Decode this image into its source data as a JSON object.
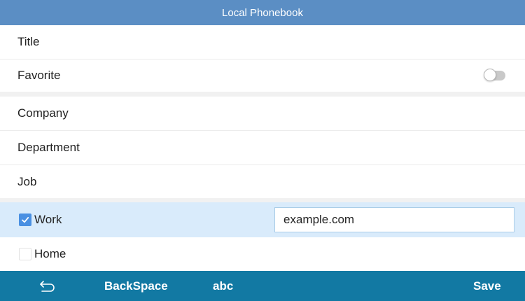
{
  "header": {
    "title": "Local Phonebook"
  },
  "fields": {
    "title": {
      "label": "Title"
    },
    "favorite": {
      "label": "Favorite",
      "toggle_on": false
    },
    "company": {
      "label": "Company"
    },
    "department": {
      "label": "Department"
    },
    "job": {
      "label": "Job"
    }
  },
  "website": {
    "work": {
      "label": "Work",
      "checked": true,
      "value": "example.com"
    },
    "home": {
      "label": "Home",
      "checked": false
    }
  },
  "keyboard_bar": {
    "back_icon": "undo-arrow-icon",
    "backspace_label": "BackSpace",
    "mode_label": "abc",
    "save_label": "Save"
  },
  "colors": {
    "header": "#5b8ec4",
    "keyboard_bar": "#1279a3",
    "selected_row": "#d9ebfb",
    "checkbox_accent": "#4a90e2"
  }
}
